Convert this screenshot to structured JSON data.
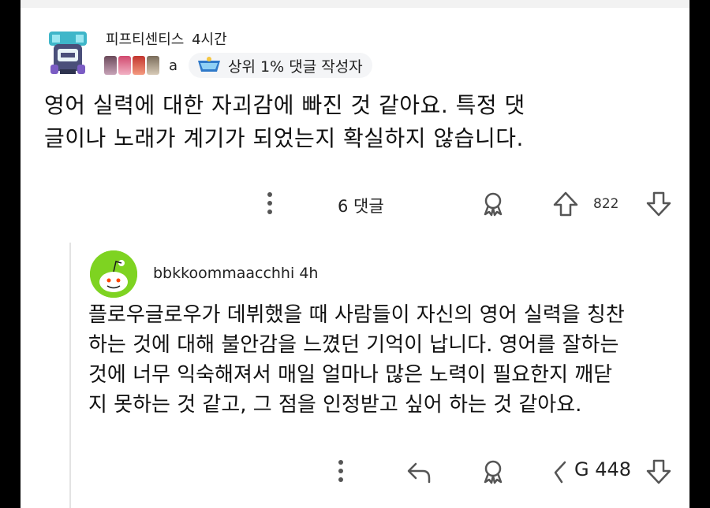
{
  "colors": {
    "background": "#ffffff",
    "text": "#1a1a1a",
    "icon": "#555555",
    "reply_avatar": "#7ed321"
  },
  "comment": {
    "username": "피프티센티스",
    "time": "4시간",
    "flair_text": "a",
    "award": {
      "icon": "crown-badge-icon",
      "text": "상위 1% 댓글 작성자"
    },
    "body_lines": [
      "영어 실력에 대한 자괴감에 빠진 것 같아요. 특정 댓",
      "글이나 노래가 계기가 되었는지 확실하지 않습니다."
    ],
    "actions": {
      "more_icon": "more-vertical-icon",
      "reply_count_label": "6 댓글",
      "award_icon": "award-icon",
      "upvote_icon": "upvote-arrow-icon",
      "score": "822",
      "downvote_icon": "downvote-arrow-icon"
    }
  },
  "reply": {
    "username": "bbkkoommaacchhi",
    "time": "4h",
    "avatar_icon": "snoo-avatar-icon",
    "body_lines": [
      "플로우글로우가 데뷔했을 때 사람들이 자신의 영어 실력을 칭찬",
      "하는 것에 대해 불안감을 느꼈던 기억이 납니다. 영어를 잘하는",
      "것에 너무 익숙해져서 매일 얼마나 많은 노력이 필요한지 깨닫",
      "지 못하는 것 같고, 그 점을 인정받고 싶어 하는 것 같아요."
    ],
    "actions": {
      "more_icon": "more-vertical-icon",
      "reply_icon": "reply-arrow-icon",
      "award_icon": "award-icon",
      "score": "448",
      "score_prefix": "G",
      "downvote_icon": "downvote-arrow-icon"
    }
  }
}
